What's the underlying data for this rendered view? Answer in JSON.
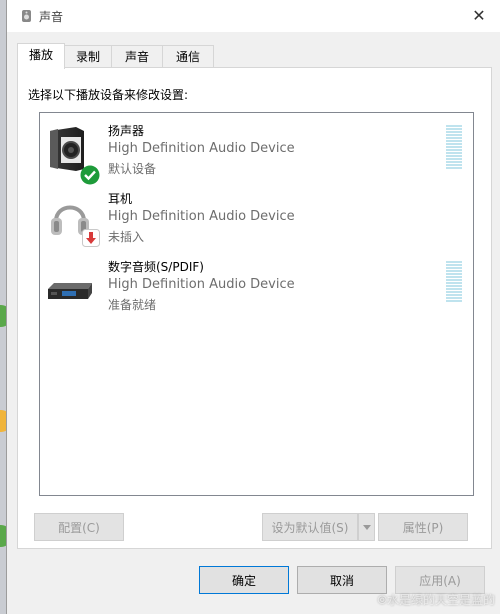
{
  "window": {
    "title": "声音",
    "close_glyph": "✕"
  },
  "tabs": [
    {
      "label": "播放",
      "active": true
    },
    {
      "label": "录制",
      "active": false
    },
    {
      "label": "声音",
      "active": false
    },
    {
      "label": "通信",
      "active": false
    }
  ],
  "instruction": "选择以下播放设备来修改设置:",
  "devices": [
    {
      "name": "扬声器",
      "description": "High Definition Audio Device",
      "status": "默认设备",
      "icon": "speaker-icon",
      "badge": "check-badge-icon"
    },
    {
      "name": "耳机",
      "description": "High Definition Audio Device",
      "status": "未插入",
      "icon": "headphones-icon",
      "badge": "unplugged-badge-icon"
    },
    {
      "name": "数字音频(S/PDIF)",
      "description": "High Definition Audio Device",
      "status": "准备就绪",
      "icon": "digital-audio-icon"
    }
  ],
  "buttons": {
    "configure": "配置(C)",
    "set_default": "设为默认值(S)",
    "properties": "属性(P)",
    "ok": "确定",
    "cancel": "取消",
    "apply": "应用(A)"
  },
  "watermark": "⦾水是绿的天空是蓝的",
  "colors": {
    "accent": "#0078d7",
    "meter": "#bfe3ee",
    "check": "#1e9b3a",
    "unplugged": "#d83b3b"
  }
}
